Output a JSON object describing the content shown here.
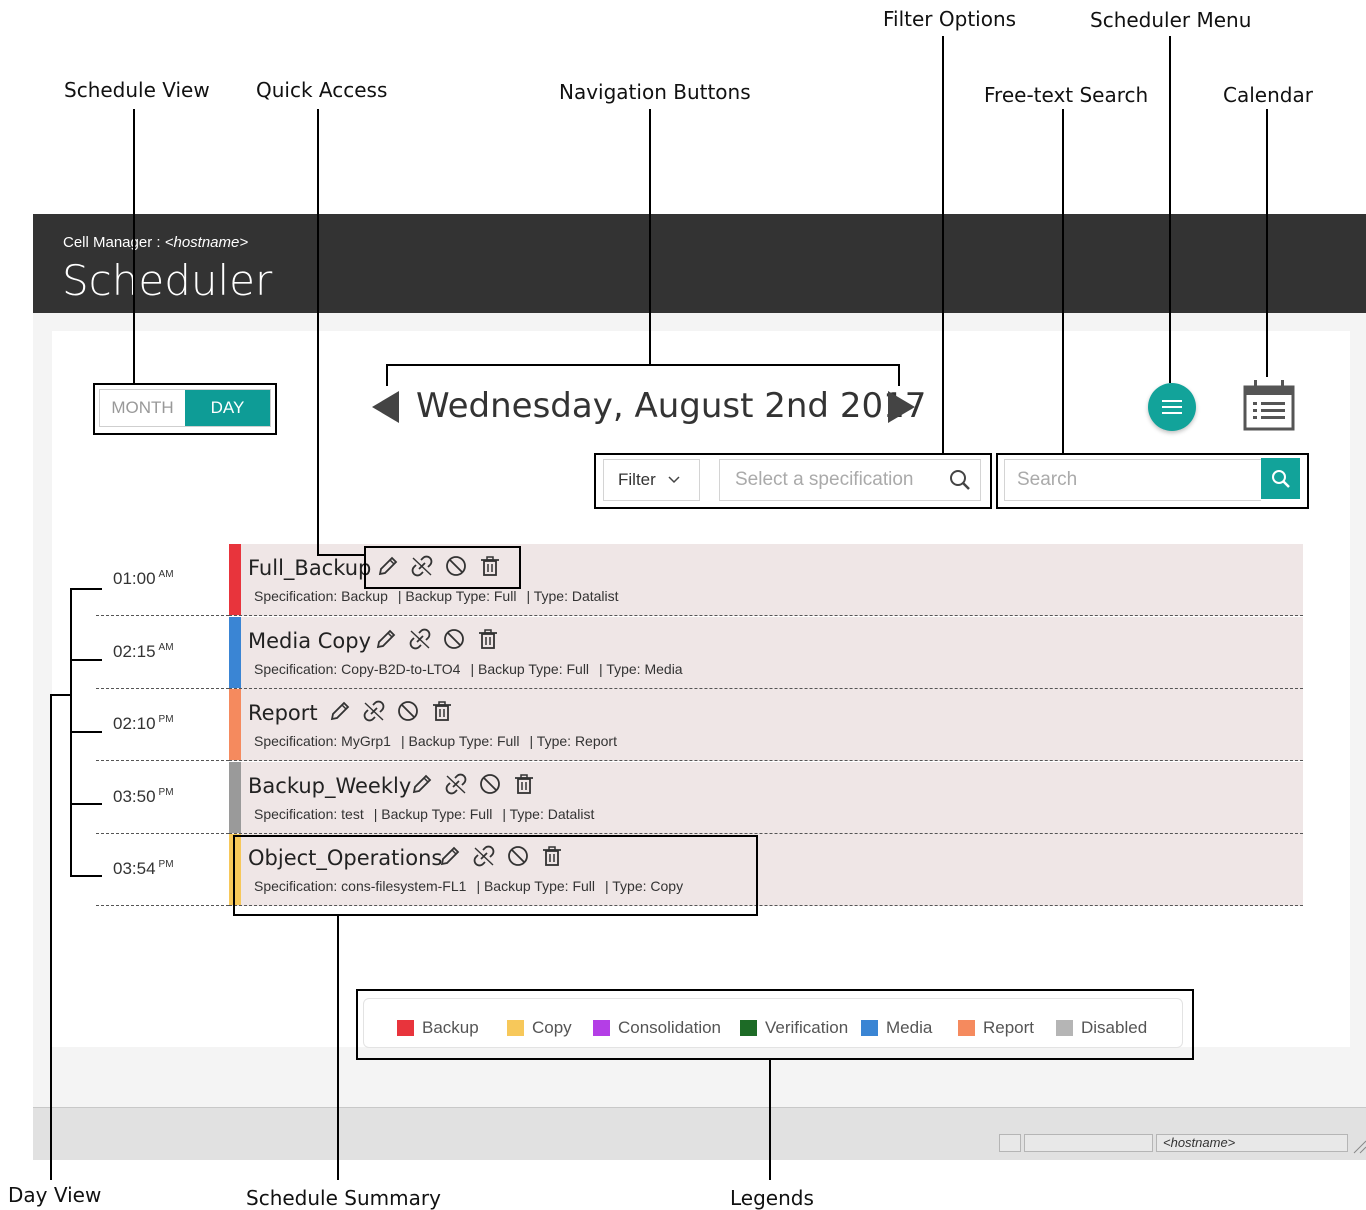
{
  "callouts": {
    "schedule_view": "Schedule View",
    "quick_access": "Quick Access",
    "navigation_buttons": "Navigation Buttons",
    "filter_options": "Filter Options",
    "scheduler_menu": "Scheduler Menu",
    "free_text_search": "Free-text Search",
    "calendar": "Calendar",
    "day_view": "Day View",
    "schedule_summary": "Schedule Summary",
    "legends": "Legends"
  },
  "header": {
    "cell_manager_label": "Cell Manager : ",
    "hostname": "<hostname>",
    "title": "Scheduler"
  },
  "view_toggle": {
    "month": "MONTH",
    "day": "DAY",
    "selected": "DAY"
  },
  "date_title": "Wednesday, August 2nd 2017",
  "filter": {
    "label": "Filter",
    "spec_placeholder": "Select a specification"
  },
  "search": {
    "placeholder": "Search"
  },
  "schedules": [
    {
      "time": "01:00",
      "ampm": "AM",
      "name": "Full_Backup",
      "color": "#e8343c",
      "spec_label": "Specification: ",
      "spec": "Backup",
      "backup_type_label": "| Backup Type: ",
      "backup_type": "Full",
      "type_label": "| Type: ",
      "type": "Datalist"
    },
    {
      "time": "02:15",
      "ampm": "AM",
      "name": "Media Copy",
      "color": "#3a85d4",
      "spec_label": "Specification: ",
      "spec": "Copy-B2D-to-LTO4",
      "backup_type_label": "| Backup Type: ",
      "backup_type": "Full",
      "type_label": "| Type: ",
      "type": "Media"
    },
    {
      "time": "02:10",
      "ampm": "PM",
      "name": "Report",
      "color": "#f58a5e",
      "spec_label": "Specification: ",
      "spec": "MyGrp1",
      "backup_type_label": "| Backup Type: ",
      "backup_type": "Full",
      "type_label": "| Type: ",
      "type": "Report"
    },
    {
      "time": "03:50",
      "ampm": "PM",
      "name": "Backup_Weekly",
      "color": "#9a9a9a",
      "spec_label": "Specification: ",
      "spec": "test",
      "backup_type_label": "| Backup Type: ",
      "backup_type": "Full",
      "type_label": "| Type: ",
      "type": "Datalist"
    },
    {
      "time": "03:54",
      "ampm": "PM",
      "name": "Object_Operations",
      "color": "#f7c85a",
      "spec_label": "Specification: ",
      "spec": "cons-filesystem-FL1",
      "backup_type_label": "| Backup Type: ",
      "backup_type": "Full",
      "type_label": "| Type: ",
      "type": "Copy"
    }
  ],
  "quick_access_icons": [
    "edit-icon",
    "unlink-icon",
    "disable-icon",
    "delete-icon"
  ],
  "legend": [
    {
      "label": "Backup",
      "color": "#e8343c"
    },
    {
      "label": "Copy",
      "color": "#f7c85a"
    },
    {
      "label": "Consolidation",
      "color": "#b43ee6"
    },
    {
      "label": "Verification",
      "color": "#1d6b26"
    },
    {
      "label": "Media",
      "color": "#3a85d4"
    },
    {
      "label": "Report",
      "color": "#f58a5e"
    },
    {
      "label": "Disabled",
      "color": "#b5b5b5"
    }
  ],
  "statusbar": {
    "hostname": "<hostname>"
  },
  "colors": {
    "accent": "#12a39a",
    "header_bg": "#333333"
  }
}
